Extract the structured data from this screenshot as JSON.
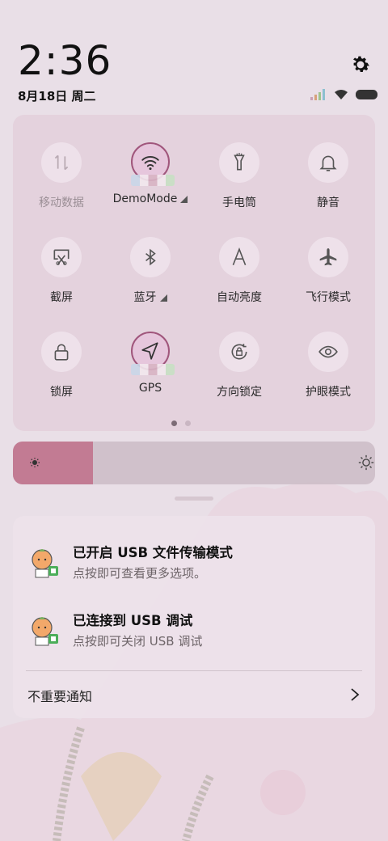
{
  "status": {
    "time": "2:36",
    "date": "8月18日 周二"
  },
  "quick_settings": {
    "tiles": [
      {
        "label": "移动数据",
        "icon": "mobile-data-icon",
        "active": false
      },
      {
        "label": "DemoMode",
        "icon": "wifi-icon",
        "active": true,
        "has_menu": true
      },
      {
        "label": "手电筒",
        "icon": "flashlight-icon",
        "active": false
      },
      {
        "label": "静音",
        "icon": "bell-icon",
        "active": false
      },
      {
        "label": "截屏",
        "icon": "screenshot-icon",
        "active": false
      },
      {
        "label": "蓝牙",
        "icon": "bluetooth-icon",
        "active": false,
        "has_menu": true
      },
      {
        "label": "自动亮度",
        "icon": "auto-brightness-icon",
        "active": false
      },
      {
        "label": "飞行模式",
        "icon": "airplane-icon",
        "active": false
      },
      {
        "label": "锁屏",
        "icon": "lock-icon",
        "active": false
      },
      {
        "label": "GPS",
        "icon": "location-arrow-icon",
        "active": true
      },
      {
        "label": "方向锁定",
        "icon": "rotation-lock-icon",
        "active": false
      },
      {
        "label": "护眼模式",
        "icon": "eye-icon",
        "active": false
      }
    ],
    "page_count": 2,
    "current_page": 1
  },
  "brightness": {
    "level": 0.22
  },
  "notifications": [
    {
      "title": "已开启 USB 文件传输模式",
      "body": "点按即可查看更多选项。",
      "icon": "usb-app-icon"
    },
    {
      "title": "已连接到 USB 调试",
      "body": "点按即可关闭 USB 调试",
      "icon": "usb-app-icon"
    }
  ],
  "unimportant_label": "不重要通知",
  "colors": {
    "accent": "#c27b93",
    "active_ring": "#a0567c",
    "panel": "#e1cdda",
    "background": "#e9dfe7"
  }
}
